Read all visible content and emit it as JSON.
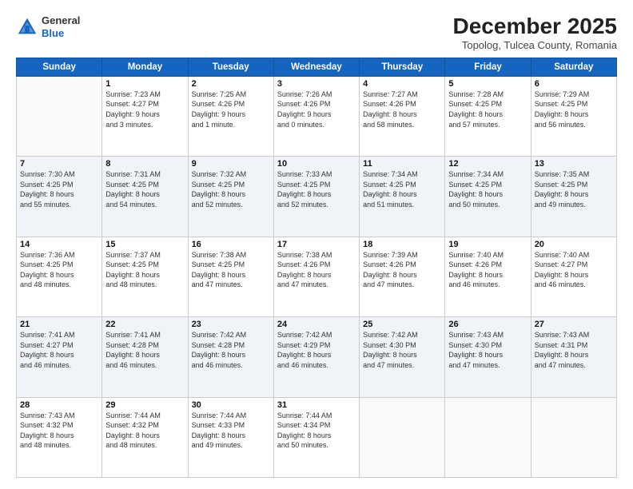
{
  "logo": {
    "general": "General",
    "blue": "Blue"
  },
  "header": {
    "month": "December 2025",
    "location": "Topolog, Tulcea County, Romania"
  },
  "days_of_week": [
    "Sunday",
    "Monday",
    "Tuesday",
    "Wednesday",
    "Thursday",
    "Friday",
    "Saturday"
  ],
  "weeks": [
    [
      {
        "day": "",
        "info": ""
      },
      {
        "day": "1",
        "info": "Sunrise: 7:23 AM\nSunset: 4:27 PM\nDaylight: 9 hours\nand 3 minutes."
      },
      {
        "day": "2",
        "info": "Sunrise: 7:25 AM\nSunset: 4:26 PM\nDaylight: 9 hours\nand 1 minute."
      },
      {
        "day": "3",
        "info": "Sunrise: 7:26 AM\nSunset: 4:26 PM\nDaylight: 9 hours\nand 0 minutes."
      },
      {
        "day": "4",
        "info": "Sunrise: 7:27 AM\nSunset: 4:26 PM\nDaylight: 8 hours\nand 58 minutes."
      },
      {
        "day": "5",
        "info": "Sunrise: 7:28 AM\nSunset: 4:25 PM\nDaylight: 8 hours\nand 57 minutes."
      },
      {
        "day": "6",
        "info": "Sunrise: 7:29 AM\nSunset: 4:25 PM\nDaylight: 8 hours\nand 56 minutes."
      }
    ],
    [
      {
        "day": "7",
        "info": "Sunrise: 7:30 AM\nSunset: 4:25 PM\nDaylight: 8 hours\nand 55 minutes."
      },
      {
        "day": "8",
        "info": "Sunrise: 7:31 AM\nSunset: 4:25 PM\nDaylight: 8 hours\nand 54 minutes."
      },
      {
        "day": "9",
        "info": "Sunrise: 7:32 AM\nSunset: 4:25 PM\nDaylight: 8 hours\nand 52 minutes."
      },
      {
        "day": "10",
        "info": "Sunrise: 7:33 AM\nSunset: 4:25 PM\nDaylight: 8 hours\nand 52 minutes."
      },
      {
        "day": "11",
        "info": "Sunrise: 7:34 AM\nSunset: 4:25 PM\nDaylight: 8 hours\nand 51 minutes."
      },
      {
        "day": "12",
        "info": "Sunrise: 7:34 AM\nSunset: 4:25 PM\nDaylight: 8 hours\nand 50 minutes."
      },
      {
        "day": "13",
        "info": "Sunrise: 7:35 AM\nSunset: 4:25 PM\nDaylight: 8 hours\nand 49 minutes."
      }
    ],
    [
      {
        "day": "14",
        "info": "Sunrise: 7:36 AM\nSunset: 4:25 PM\nDaylight: 8 hours\nand 48 minutes."
      },
      {
        "day": "15",
        "info": "Sunrise: 7:37 AM\nSunset: 4:25 PM\nDaylight: 8 hours\nand 48 minutes."
      },
      {
        "day": "16",
        "info": "Sunrise: 7:38 AM\nSunset: 4:25 PM\nDaylight: 8 hours\nand 47 minutes."
      },
      {
        "day": "17",
        "info": "Sunrise: 7:38 AM\nSunset: 4:26 PM\nDaylight: 8 hours\nand 47 minutes."
      },
      {
        "day": "18",
        "info": "Sunrise: 7:39 AM\nSunset: 4:26 PM\nDaylight: 8 hours\nand 47 minutes."
      },
      {
        "day": "19",
        "info": "Sunrise: 7:40 AM\nSunset: 4:26 PM\nDaylight: 8 hours\nand 46 minutes."
      },
      {
        "day": "20",
        "info": "Sunrise: 7:40 AM\nSunset: 4:27 PM\nDaylight: 8 hours\nand 46 minutes."
      }
    ],
    [
      {
        "day": "21",
        "info": "Sunrise: 7:41 AM\nSunset: 4:27 PM\nDaylight: 8 hours\nand 46 minutes."
      },
      {
        "day": "22",
        "info": "Sunrise: 7:41 AM\nSunset: 4:28 PM\nDaylight: 8 hours\nand 46 minutes."
      },
      {
        "day": "23",
        "info": "Sunrise: 7:42 AM\nSunset: 4:28 PM\nDaylight: 8 hours\nand 46 minutes."
      },
      {
        "day": "24",
        "info": "Sunrise: 7:42 AM\nSunset: 4:29 PM\nDaylight: 8 hours\nand 46 minutes."
      },
      {
        "day": "25",
        "info": "Sunrise: 7:42 AM\nSunset: 4:30 PM\nDaylight: 8 hours\nand 47 minutes."
      },
      {
        "day": "26",
        "info": "Sunrise: 7:43 AM\nSunset: 4:30 PM\nDaylight: 8 hours\nand 47 minutes."
      },
      {
        "day": "27",
        "info": "Sunrise: 7:43 AM\nSunset: 4:31 PM\nDaylight: 8 hours\nand 47 minutes."
      }
    ],
    [
      {
        "day": "28",
        "info": "Sunrise: 7:43 AM\nSunset: 4:32 PM\nDaylight: 8 hours\nand 48 minutes."
      },
      {
        "day": "29",
        "info": "Sunrise: 7:44 AM\nSunset: 4:32 PM\nDaylight: 8 hours\nand 48 minutes."
      },
      {
        "day": "30",
        "info": "Sunrise: 7:44 AM\nSunset: 4:33 PM\nDaylight: 8 hours\nand 49 minutes."
      },
      {
        "day": "31",
        "info": "Sunrise: 7:44 AM\nSunset: 4:34 PM\nDaylight: 8 hours\nand 50 minutes."
      },
      {
        "day": "",
        "info": ""
      },
      {
        "day": "",
        "info": ""
      },
      {
        "day": "",
        "info": ""
      }
    ]
  ]
}
